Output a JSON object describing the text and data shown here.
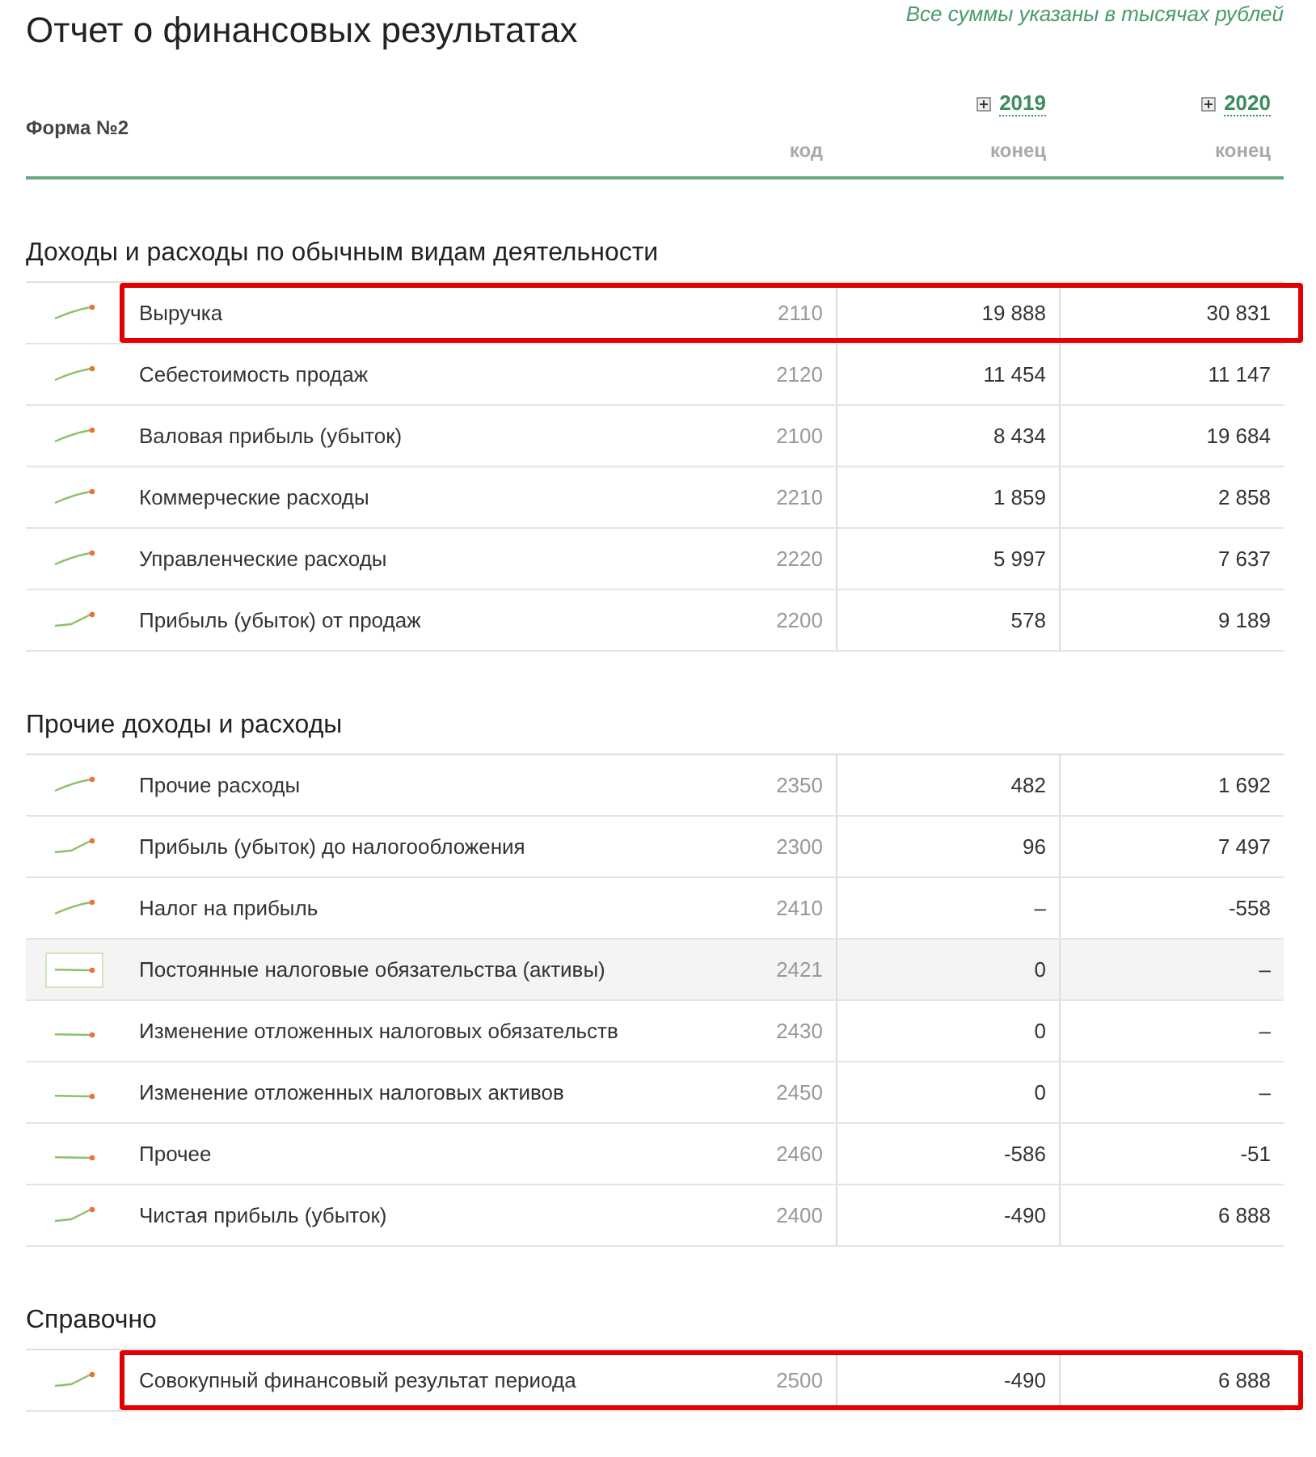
{
  "note": "Все суммы указаны в тысячах рублей",
  "title": "Отчет о финансовых результатах",
  "form_label": "Форма №2",
  "columns": [
    {
      "label": "код"
    },
    {
      "year": "2019",
      "label": "конец"
    },
    {
      "year": "2020",
      "label": "конец"
    }
  ],
  "sections": [
    {
      "title": "Доходы и расходы по обычным видам деятельности",
      "rows": [
        {
          "name": "Выручка",
          "code": "2110",
          "values": [
            "19 888",
            "30 831"
          ],
          "kind": "up",
          "highlighted": false,
          "outlined": true
        },
        {
          "name": "Себестоимость продаж",
          "code": "2120",
          "values": [
            "11 454",
            "11 147"
          ],
          "kind": "up",
          "highlighted": false,
          "outlined": false
        },
        {
          "name": "Валовая прибыль (убыток)",
          "code": "2100",
          "values": [
            "8 434",
            "19 684"
          ],
          "kind": "up",
          "highlighted": false,
          "outlined": false
        },
        {
          "name": "Коммерческие расходы",
          "code": "2210",
          "values": [
            "1 859",
            "2 858"
          ],
          "kind": "up",
          "highlighted": false,
          "outlined": false
        },
        {
          "name": "Управленческие расходы",
          "code": "2220",
          "values": [
            "5 997",
            "7 637"
          ],
          "kind": "up",
          "highlighted": false,
          "outlined": false
        },
        {
          "name": "Прибыль (убыток) от продаж",
          "code": "2200",
          "values": [
            "578",
            "9 189"
          ],
          "kind": "hook",
          "highlighted": false,
          "outlined": false
        }
      ]
    },
    {
      "title": "Прочие доходы и расходы",
      "rows": [
        {
          "name": "Прочие расходы",
          "code": "2350",
          "values": [
            "482",
            "1 692"
          ],
          "kind": "up",
          "highlighted": false,
          "outlined": false
        },
        {
          "name": "Прибыль (убыток) до налогообложения",
          "code": "2300",
          "values": [
            "96",
            "7 497"
          ],
          "kind": "hook",
          "highlighted": false,
          "outlined": false
        },
        {
          "name": "Налог на прибыль",
          "code": "2410",
          "values": [
            "–",
            "-558"
          ],
          "kind": "up",
          "highlighted": false,
          "outlined": false
        },
        {
          "name": "Постоянные налоговые обязательства (активы)",
          "code": "2421",
          "values": [
            "0",
            "–"
          ],
          "kind": "flat",
          "highlighted": true,
          "outlined": false
        },
        {
          "name": "Изменение отложенных налоговых обязательств",
          "code": "2430",
          "values": [
            "0",
            "–"
          ],
          "kind": "flat",
          "highlighted": false,
          "outlined": false
        },
        {
          "name": "Изменение отложенных налоговых активов",
          "code": "2450",
          "values": [
            "0",
            "–"
          ],
          "kind": "flat",
          "highlighted": false,
          "outlined": false
        },
        {
          "name": "Прочее",
          "code": "2460",
          "values": [
            "-586",
            "-51"
          ],
          "kind": "flat",
          "highlighted": false,
          "outlined": false
        },
        {
          "name": "Чистая прибыль (убыток)",
          "code": "2400",
          "values": [
            "-490",
            "6 888"
          ],
          "kind": "hook",
          "highlighted": false,
          "outlined": false
        }
      ]
    },
    {
      "title": "Справочно",
      "rows": [
        {
          "name": "Совокупный финансовый результат периода",
          "code": "2500",
          "values": [
            "-490",
            "6 888"
          ],
          "kind": "hook",
          "highlighted": false,
          "outlined": true
        }
      ]
    }
  ]
}
